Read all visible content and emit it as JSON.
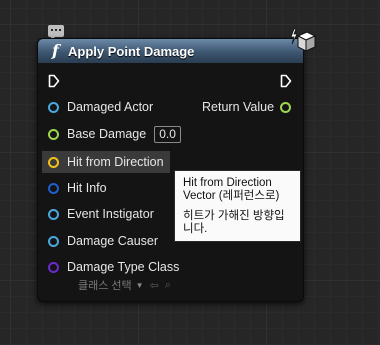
{
  "node": {
    "title": "Apply Point Damage",
    "header_color": "#4a6a8a",
    "function_glyph": "f",
    "icons": [
      "comment-icon",
      "function-icon",
      "server-authority-icon"
    ]
  },
  "pins": {
    "inputs": [
      {
        "label": "Damaged Actor",
        "color": "#4aa8e0",
        "kind": "object-reference"
      },
      {
        "label": "Base Damage",
        "color": "#9ed64e",
        "kind": "float",
        "default_value": "0.0"
      },
      {
        "label": "Hit from Direction",
        "color": "#f2c21b",
        "kind": "vector"
      },
      {
        "label": "Hit Info",
        "color": "#1f5fcf",
        "kind": "struct"
      },
      {
        "label": "Event Instigator",
        "color": "#4aa8e0",
        "kind": "object-reference"
      },
      {
        "label": "Damage Causer",
        "color": "#4aa8e0",
        "kind": "object-reference"
      },
      {
        "label": "Damage Type Class",
        "color": "#6a2ad0",
        "kind": "class-reference",
        "dropdown_value": "클래스 선택"
      }
    ],
    "outputs": [
      {
        "label": "Return Value",
        "color": "#9ed64e",
        "kind": "float"
      }
    ]
  },
  "tooltip": {
    "line1": "Hit from Direction",
    "line2": "Vector (레퍼런스로)",
    "line3": "히트가 가해진 방향입니다."
  }
}
